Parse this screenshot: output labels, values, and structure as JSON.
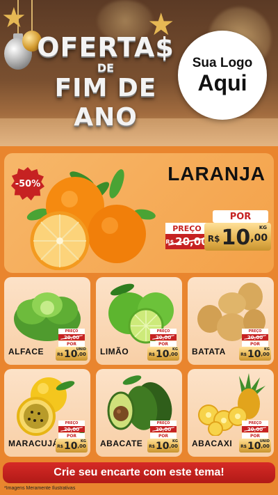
{
  "header": {
    "title_line1": "OFERTA$",
    "title_line2": "DE",
    "title_line3": "FIM DE ANO",
    "logo_line1": "Sua Logo",
    "logo_line2": "Aqui"
  },
  "feature": {
    "name": "LARANJA",
    "discount": "-50%",
    "por_label": "POR",
    "preco_label": "PREÇO",
    "old_currency": "R$",
    "old_price": "20,00",
    "currency": "R$",
    "price_int": "10",
    "price_dec": ",00",
    "unit": "KG"
  },
  "products": [
    {
      "name": "ALFACE",
      "unit": "UNID",
      "old_price": "20,00",
      "price_int": "10",
      "price_dec": ",00"
    },
    {
      "name": "LIMÃO",
      "unit": "KG",
      "old_price": "20,00",
      "price_int": "10",
      "price_dec": ",00"
    },
    {
      "name": "BATATA",
      "unit": "KG",
      "old_price": "20,00",
      "price_int": "10",
      "price_dec": ",00"
    },
    {
      "name": "MARACUJÁ",
      "unit": "KG",
      "old_price": "20,00",
      "price_int": "10",
      "price_dec": ",00"
    },
    {
      "name": "ABACATE",
      "unit": "KG",
      "old_price": "20,00",
      "price_int": "10",
      "price_dec": ",00"
    },
    {
      "name": "ABACAXI",
      "unit": "UNID",
      "old_price": "20,00",
      "price_int": "10",
      "price_dec": ",00"
    }
  ],
  "labels": {
    "preco": "PREÇO",
    "por": "POR",
    "currency": "R$",
    "old_currency": "R$"
  },
  "cta": {
    "label": "Crie seu encarte com este tema!"
  },
  "disclaimer": "*Imagens Meramente Ilustrativas",
  "colors": {
    "accent": "#c62222",
    "background": "#e9852e",
    "gold": "#e6b450"
  }
}
